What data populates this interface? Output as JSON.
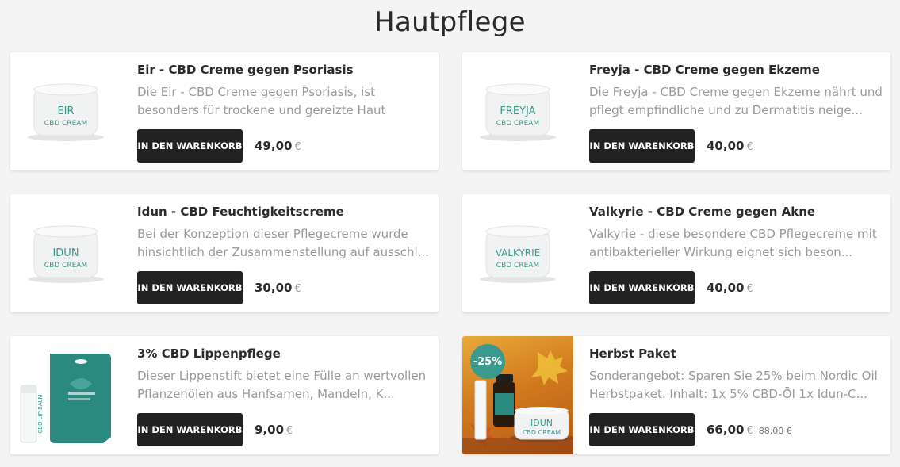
{
  "page": {
    "title": "Hautpflege"
  },
  "cart_label": "IN DEN WARENKORB",
  "currency": "€",
  "products": [
    {
      "title": "Eir - CBD Creme gegen Psoriasis",
      "description": "Die Eir - CBD Creme gegen Psoriasis, ist besonders für trockene und gereizte Haut",
      "price": "49,00",
      "jar_name": "EIR",
      "jar_sub": "CBD CREAM"
    },
    {
      "title": "Freyja - CBD Creme gegen Ekzeme",
      "description": "Die Freyja - CBD Creme gegen Ekzeme nährt und pflegt empfindliche und zu Dermatitis neige...",
      "price": "40,00",
      "jar_name": "FREYJA",
      "jar_sub": "CBD CREAM"
    },
    {
      "title": "Idun - CBD Feuchtigkeitscreme",
      "description": "Bei der Konzeption dieser Pflegecreme wurde hinsichtlich der Zusammenstellung auf ausschl...",
      "price": "30,00",
      "jar_name": "IDUN",
      "jar_sub": "CBD CREAM"
    },
    {
      "title": "Valkyrie - CBD Creme gegen Akne",
      "description": "Valkyrie - diese besondere CBD Pflegecreme mit antibakterieller Wirkung eignet sich beson...",
      "price": "40,00",
      "jar_name": "VALKYRIE",
      "jar_sub": "CBD CREAM"
    },
    {
      "title": "3% CBD Lippenpflege",
      "description": "Dieser Lippenstift bietet eine Fülle an wertvollen Pflanzenölen aus Hanfsamen, Mandeln, K...",
      "price": "9,00",
      "stick_label": "CBD LIP BALM"
    },
    {
      "title": "Herbst Paket",
      "description": "Sonderangebot: Sparen Sie 25% beim Nordic Oil Herbstpaket. Inhalt: 1x 5% CBD-Öl 1x Idun-C...",
      "price": "66,00",
      "old_price": "88,00 €",
      "badge": "-25%",
      "jar_name": "IDUN",
      "jar_sub": "CBD CREAM"
    }
  ],
  "colors": {
    "accent": "#3a9a8e",
    "button": "#222222",
    "muted_text": "#9a9a9a"
  }
}
